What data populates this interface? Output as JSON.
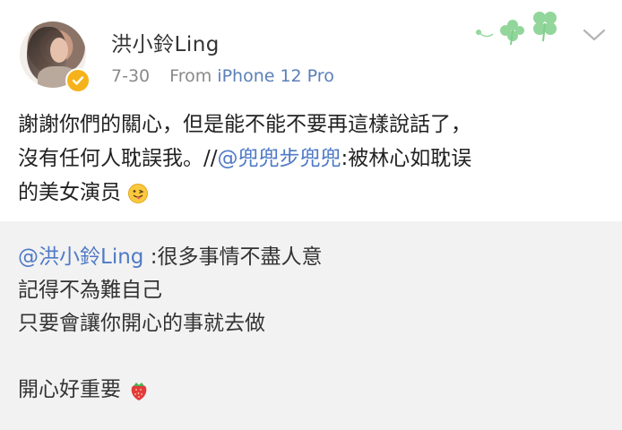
{
  "post": {
    "username": "洪小鈴Ling",
    "time": "7-30",
    "source_prefix": "From",
    "source_device": "iPhone 12 Pro",
    "text_lines": [
      "謝謝你們的關心，但是能不能不要再這樣說話了，",
      "沒有任何人耽誤我。//"
    ],
    "mention": "@兜兜步兜兜",
    "after_mention": ":被林心如耽误",
    "last_line": "的美女演员",
    "emoji_name": "tongue-out-emoji"
  },
  "repost": {
    "mention": "@洪小鈴Ling",
    "first_line_rest": " :很多事情不盡人意",
    "lines": [
      "記得不為難自己",
      "只要會讓你開心的事就去做"
    ],
    "last_line": "開心好重要",
    "emoji_name": "strawberry-emoji"
  },
  "icons": {
    "decoration": "clover-icon",
    "menu": "chevron-down-icon",
    "verified": "verified-badge-icon"
  },
  "colors": {
    "link": "#4f7ac6",
    "repost_bg": "#f2f2f2",
    "badge": "#f6b21b"
  }
}
